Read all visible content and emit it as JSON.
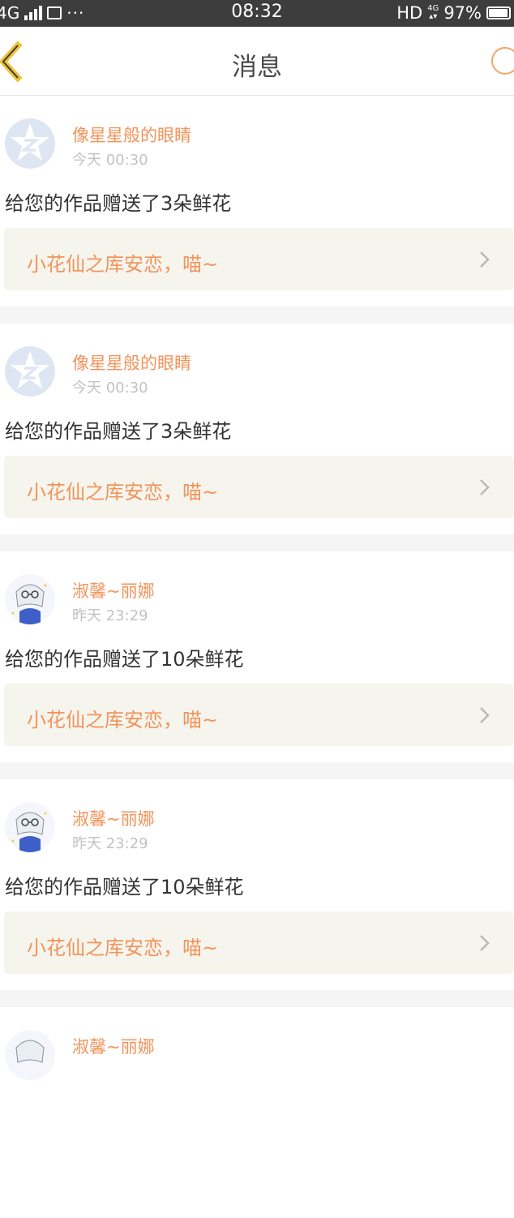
{
  "status_bar": {
    "network_left": "4G",
    "dots": "···",
    "time": "08:32",
    "hd": "HD",
    "network_right": "4G",
    "battery": "97%"
  },
  "nav": {
    "title": "消息",
    "back_icon": "chevron-left-icon",
    "refresh_icon": "refresh-icon"
  },
  "colors": {
    "accent": "#f3935a",
    "card_bg": "#f5f5ee",
    "separator": "#f5f5f5"
  },
  "messages": [
    {
      "sender": "像星星般的眼睛",
      "time": "今天 00:30",
      "text": "给您的作品赠送了3朵鲜花",
      "work_title": "小花仙之库安恋，喵~",
      "avatar": "qq-star-avatar"
    },
    {
      "sender": "像星星般的眼睛",
      "time": "今天 00:30",
      "text": "给您的作品赠送了3朵鲜花",
      "work_title": "小花仙之库安恋，喵~",
      "avatar": "qq-star-avatar"
    },
    {
      "sender": "淑馨~丽娜",
      "time": "昨天 23:29",
      "text": "给您的作品赠送了10朵鲜花",
      "work_title": "小花仙之库安恋，喵~",
      "avatar": "anime-girl-avatar"
    },
    {
      "sender": "淑馨~丽娜",
      "time": "昨天 23:29",
      "text": "给您的作品赠送了10朵鲜花",
      "work_title": "小花仙之库安恋，喵~",
      "avatar": "anime-girl-avatar"
    }
  ]
}
